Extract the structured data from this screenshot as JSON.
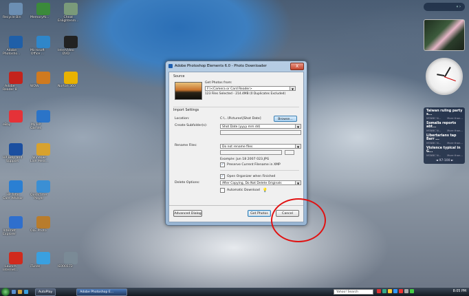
{
  "desktop_icons": [
    {
      "label": "Recycle Bin",
      "icon": "recycle-bin-icon",
      "color": "#6c8fb3"
    },
    {
      "label": "MemoryAl...",
      "icon": "memory-icon",
      "color": "#3b8a3b"
    },
    {
      "label": "Cheat\nEnlightenm...",
      "icon": "cheat-icon",
      "color": "#7a9a7a"
    },
    {
      "label": "Adobe\nPhotosho...",
      "icon": "photoshop-icon",
      "color": "#1f5fa8"
    },
    {
      "label": "Microsoft\nOffice ...",
      "icon": "office-icon",
      "color": "#2f86c9"
    },
    {
      "label": "InterVideo\nDVD",
      "icon": "dvd-icon",
      "color": "#222222"
    },
    {
      "label": "Adobe\nReader 8",
      "icon": "adobe-reader-icon",
      "color": "#c4231c"
    },
    {
      "label": "WOW",
      "icon": "wow-icon",
      "color": "#d07a1f"
    },
    {
      "label": "Norton 360",
      "icon": "norton-icon",
      "color": "#e8b200"
    },
    {
      "label": "eBay",
      "icon": "ebay-icon",
      "color": "#e53238"
    },
    {
      "label": "My HP\nGames",
      "icon": "hp-games-icon",
      "color": "#2b74c8"
    },
    {
      "label": "HP Help and\nSupport",
      "icon": "help-icon",
      "color": "#1b4fa0"
    },
    {
      "label": "Windows\nLive Mess...",
      "icon": "messenger-icon",
      "color": "#d8a22e"
    },
    {
      "label": "HP Total\nCare Advisor",
      "icon": "hp-care-icon",
      "color": "#2a7fd3"
    },
    {
      "label": "QuickTime\nPlayer",
      "icon": "quicktime-icon",
      "color": "#3b8fd4"
    },
    {
      "label": "Internet\nExplorer",
      "icon": "ie-icon",
      "color": "#2f6fcd"
    },
    {
      "label": "OLE Photo",
      "icon": "photo-icon",
      "color": "#b87c2c"
    },
    {
      "label": "Launch\nInternet...",
      "icon": "launch-icon",
      "color": "#d12a1d"
    },
    {
      "label": "iTunes",
      "icon": "itunes-icon",
      "color": "#3aa0e0"
    },
    {
      "label": "IE000172",
      "icon": "image-file-icon",
      "color": "#7a8a96"
    }
  ],
  "gadgets": {
    "control_label": "« ›",
    "news": [
      {
        "headline": "Taiwan ruling party s...",
        "source": "MSNBC N...",
        "time": "More than..."
      },
      {
        "headline": "Somalia reports abt...",
        "source": "MSNBC N...",
        "time": "More than..."
      },
      {
        "headline": "Libertarians tap Barr ...",
        "source": "MSNBC N...",
        "time": "More than..."
      },
      {
        "headline": "Violence typical in G...",
        "source": "MSNBC N...",
        "time": "More than..."
      }
    ],
    "news_nav": "◄ 97-100 ►"
  },
  "dialog": {
    "title": "Adobe Photoshop Elements 6.0 - Photo Downloader",
    "close_label": "X",
    "source_section": "Source",
    "get_photos_label": "Get Photos from:",
    "get_photos_value": "F:\\<Camera or Card Reader>",
    "files_summary": "123 Files Selected - 214.4MB (0 Duplicates Excluded)",
    "import_section": "Import Settings",
    "location_label": "Location:",
    "location_value": "C:\\...\\Pictures\\[Shot Date]",
    "browse_label": "Browse...",
    "subfolder_label": "Create Subfolder(s):",
    "subfolder_value": "Shot Date (yyyy mm dd)",
    "rename_label": "Rename Files:",
    "rename_value": "Do not rename files",
    "rename_example": "Example: Jun 18 2007 023.JPG",
    "preserve_label": "Preserve Current Filename in XMP",
    "open_organizer_label": "Open Organizer when Finished",
    "delete_label": "Delete Options:",
    "delete_value": "After Copying, Do Not Delete Originals",
    "auto_download_label": "Automatic Download",
    "advanced_label": "Advanced Dialog",
    "get_photos_button": "Get Photos",
    "cancel_button": "Cancel",
    "check_mark": "✓"
  },
  "taskbar": {
    "items": [
      "AutoPlay",
      "Adobe Photoshop E..."
    ],
    "search_placeholder": "Yahoo! Search",
    "clock": "8:05 PM"
  },
  "colors": {
    "annotation": "#e11111"
  }
}
